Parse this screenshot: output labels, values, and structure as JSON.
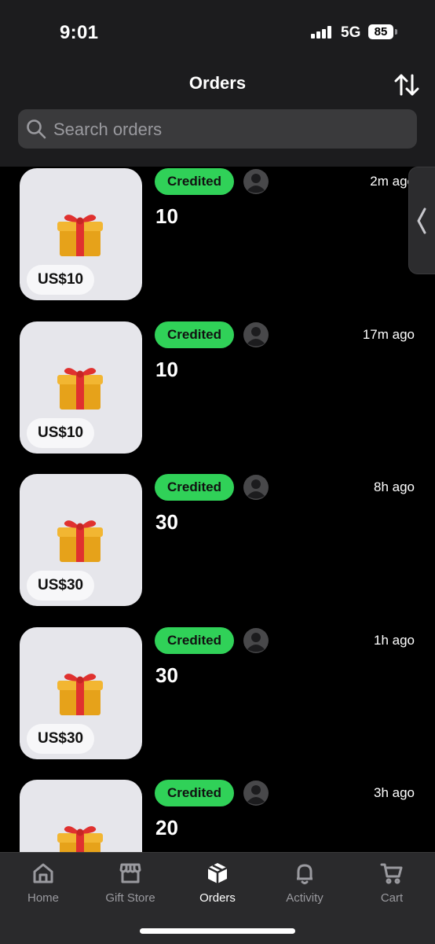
{
  "status_bar": {
    "time": "9:01",
    "network": "5G",
    "battery": "85"
  },
  "header": {
    "title": "Orders",
    "sort_icon": "sort-arrows-icon"
  },
  "search": {
    "placeholder": "Search orders",
    "value": ""
  },
  "orders": [
    {
      "card_amount": "US$10",
      "status": "Credited",
      "time_ago": "2m ago",
      "quantity": "10"
    },
    {
      "card_amount": "US$10",
      "status": "Credited",
      "time_ago": "17m ago",
      "quantity": "10"
    },
    {
      "card_amount": "US$30",
      "status": "Credited",
      "time_ago": "8h ago",
      "quantity": "30"
    },
    {
      "card_amount": "US$30",
      "status": "Credited",
      "time_ago": "1h ago",
      "quantity": "30"
    },
    {
      "card_amount": "",
      "status": "Credited",
      "time_ago": "3h ago",
      "quantity": "20"
    }
  ],
  "tabs": [
    {
      "label": "Home",
      "icon": "home-icon",
      "active": false
    },
    {
      "label": "Gift Store",
      "icon": "store-icon",
      "active": false
    },
    {
      "label": "Orders",
      "icon": "box-icon",
      "active": true
    },
    {
      "label": "Activity",
      "icon": "bell-icon",
      "active": false
    },
    {
      "label": "Cart",
      "icon": "cart-icon",
      "active": false
    }
  ],
  "colors": {
    "credited": "#30d158",
    "background": "#000000",
    "header_bg": "#1c1c1e",
    "card_bg": "#e6e6eb"
  }
}
